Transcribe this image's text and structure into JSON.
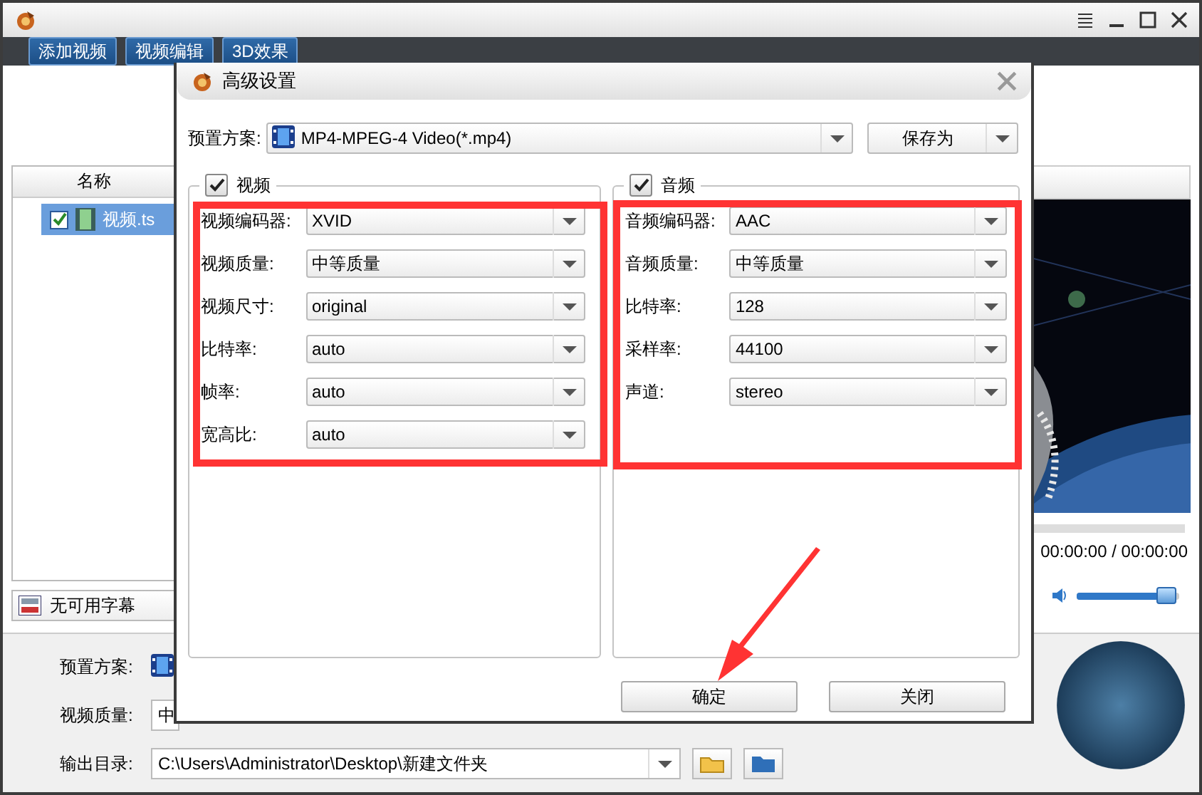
{
  "toolbar": {
    "buttons": [
      "添加视频",
      "视频编辑",
      "3D效果"
    ]
  },
  "file_list": {
    "header": "名称",
    "items": [
      {
        "name": "视频.ts",
        "checked": true,
        "selected": true
      }
    ]
  },
  "subtitle": {
    "value": "无可用字幕"
  },
  "player": {
    "progress": {
      "level": 0
    },
    "time": "00:00:00 / 00:00:00",
    "volume": {
      "level": 0.92
    }
  },
  "output": {
    "fields": [
      {
        "kind": "icon",
        "label": "预置方案:"
      },
      {
        "kind": "text",
        "label": "视频质量:",
        "value": "中"
      },
      {
        "kind": "path",
        "label": "输出目录:",
        "value": "C:\\Users\\Administrator\\Desktop\\新建文件夹"
      }
    ]
  },
  "dialog": {
    "title": "高级设置",
    "preset": {
      "label": "预置方案:",
      "value": "MP4-MPEG-4 Video(*.mp4)"
    },
    "save_as": "保存为",
    "groups": [
      {
        "title": "视频",
        "checked": true,
        "settings": [
          {
            "label": "视频编码器:",
            "value": "XVID"
          },
          {
            "label": "视频质量:",
            "value": "中等质量"
          },
          {
            "label": "视频尺寸:",
            "value": "original"
          },
          {
            "label": "比特率:",
            "value": "auto"
          },
          {
            "label": "帧率:",
            "value": "auto"
          },
          {
            "label": "宽高比:",
            "value": "auto"
          }
        ]
      },
      {
        "title": "音频",
        "checked": true,
        "settings": [
          {
            "label": "音频编码器:",
            "value": "AAC"
          },
          {
            "label": "音频质量:",
            "value": "中等质量"
          },
          {
            "label": "比特率:",
            "value": "128"
          },
          {
            "label": "采样率:",
            "value": "44100"
          },
          {
            "label": "声道:",
            "value": "stereo"
          }
        ]
      }
    ],
    "buttons": [
      "确定",
      "关闭"
    ]
  }
}
